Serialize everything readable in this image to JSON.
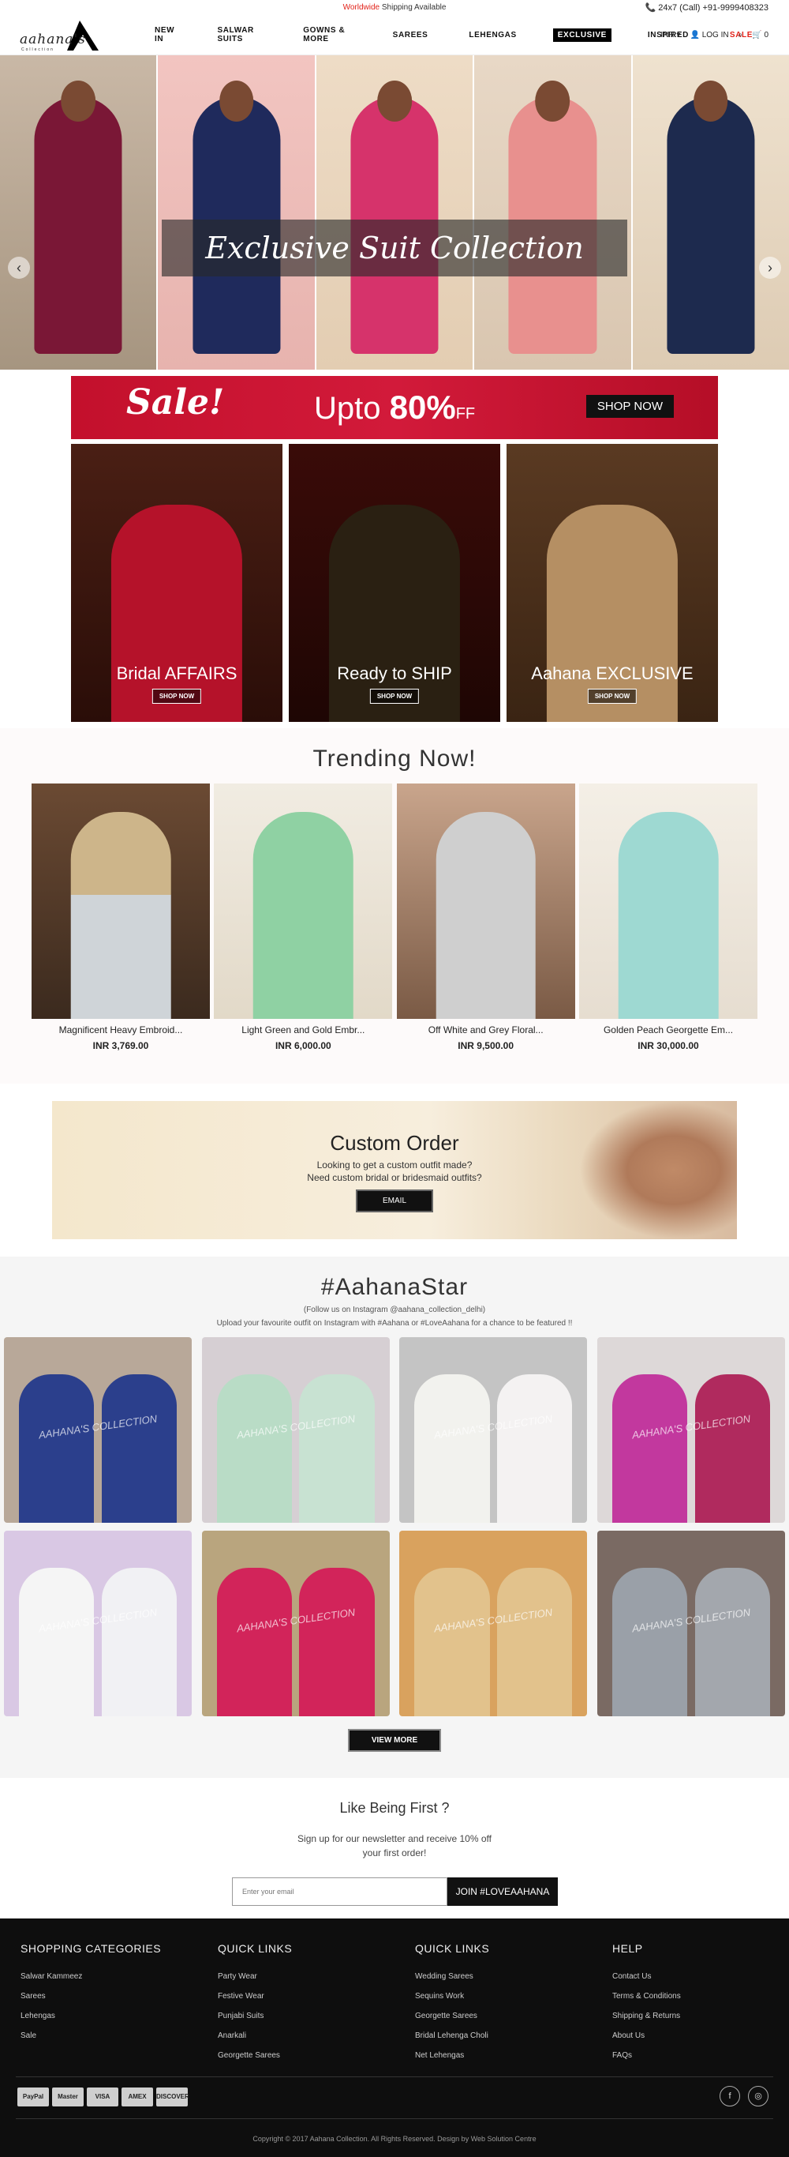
{
  "topbar": {
    "shipping_highlight": "Worldwide",
    "shipping_rest": "Shipping Available",
    "phone": "📞 24x7 (Call) +91-9999408323"
  },
  "logo": {
    "text": "aahana's",
    "sub": "Collection"
  },
  "menu": [
    "NEW IN",
    "SALWAR SUITS",
    "GOWNS & MORE",
    "SAREES",
    "LEHENGAS",
    "EXCLUSIVE",
    "INSPIRED",
    "SALE"
  ],
  "tools": {
    "currency": "INR ▾",
    "login": "LOG IN",
    "cart": "0"
  },
  "hero": {
    "caption": "Exclusive Suit Collection",
    "prev": "‹",
    "next": "›"
  },
  "sale": {
    "script": "Sale!",
    "upto": "Upto",
    "percent": "80%",
    "off": "FF",
    "button": "SHOP NOW"
  },
  "categories": [
    {
      "label": "Bridal AFFAIRS",
      "button": "SHOP NOW"
    },
    {
      "label": "Ready to SHIP",
      "button": "SHOP NOW"
    },
    {
      "label": "Aahana EXCLUSIVE",
      "button": "SHOP NOW"
    }
  ],
  "trending": {
    "title": "Trending Now!",
    "products": [
      {
        "name": "Magnificent Heavy Embroid...",
        "price": "INR 3,769.00"
      },
      {
        "name": "Light Green and Gold Embr...",
        "price": "INR 6,000.00"
      },
      {
        "name": "Off White and Grey Floral...",
        "price": "INR 9,500.00"
      },
      {
        "name": "Golden Peach Georgette Em...",
        "price": "INR 30,000.00"
      }
    ]
  },
  "custom": {
    "title": "Custom Order",
    "line1": "Looking to get a custom outfit made?",
    "line2": "Need custom bridal or bridesmaid outfits?",
    "button": "EMAIL"
  },
  "star": {
    "title": "#AahanaStar",
    "line1": "(Follow us on Instagram @aahana_collection_delhi)",
    "line2": "Upload your favourite outfit on Instagram with #Aahana or #LoveAahana for a chance to be featured !!",
    "watermark": "AAHANA'S COLLECTION",
    "button": "VIEW MORE"
  },
  "newsletter": {
    "title": "Like Being First ?",
    "line1": "Sign up for our newsletter and receive 10% off",
    "line2": "your first order!",
    "placeholder": "Enter your email",
    "button": "JOIN #LOVEAAHANA"
  },
  "footer": {
    "columns": [
      {
        "title": "SHOPPING CATEGORIES",
        "links": [
          "Salwar Kammeez",
          "Sarees",
          "Lehengas",
          "Sale"
        ]
      },
      {
        "title": "QUICK LINKS",
        "links": [
          "Party Wear",
          "Festive Wear",
          "Punjabi Suits",
          "Anarkali",
          "Georgette Sarees"
        ]
      },
      {
        "title": "QUICK LINKS",
        "links": [
          "Wedding Sarees",
          "Sequins Work",
          "Georgette Sarees",
          "Bridal Lehenga Choli",
          "Net Lehengas"
        ]
      },
      {
        "title": "HELP",
        "links": [
          "Contact Us",
          "Terms & Conditions",
          "Shipping & Returns",
          "About Us",
          "FAQs"
        ]
      }
    ],
    "payments": [
      "PayPal",
      "Master",
      "VISA",
      "AMEX",
      "DISCOVER"
    ],
    "social": [
      "f",
      "◎"
    ],
    "copyright": "Copyright © 2017 Aahana Collection. All Rights Reserved. Design by Web Solution Centre"
  },
  "colors": {
    "accent_red": "#e2231a",
    "footer_bg": "#0e0e0e",
    "sale_red": "#c3102c"
  }
}
